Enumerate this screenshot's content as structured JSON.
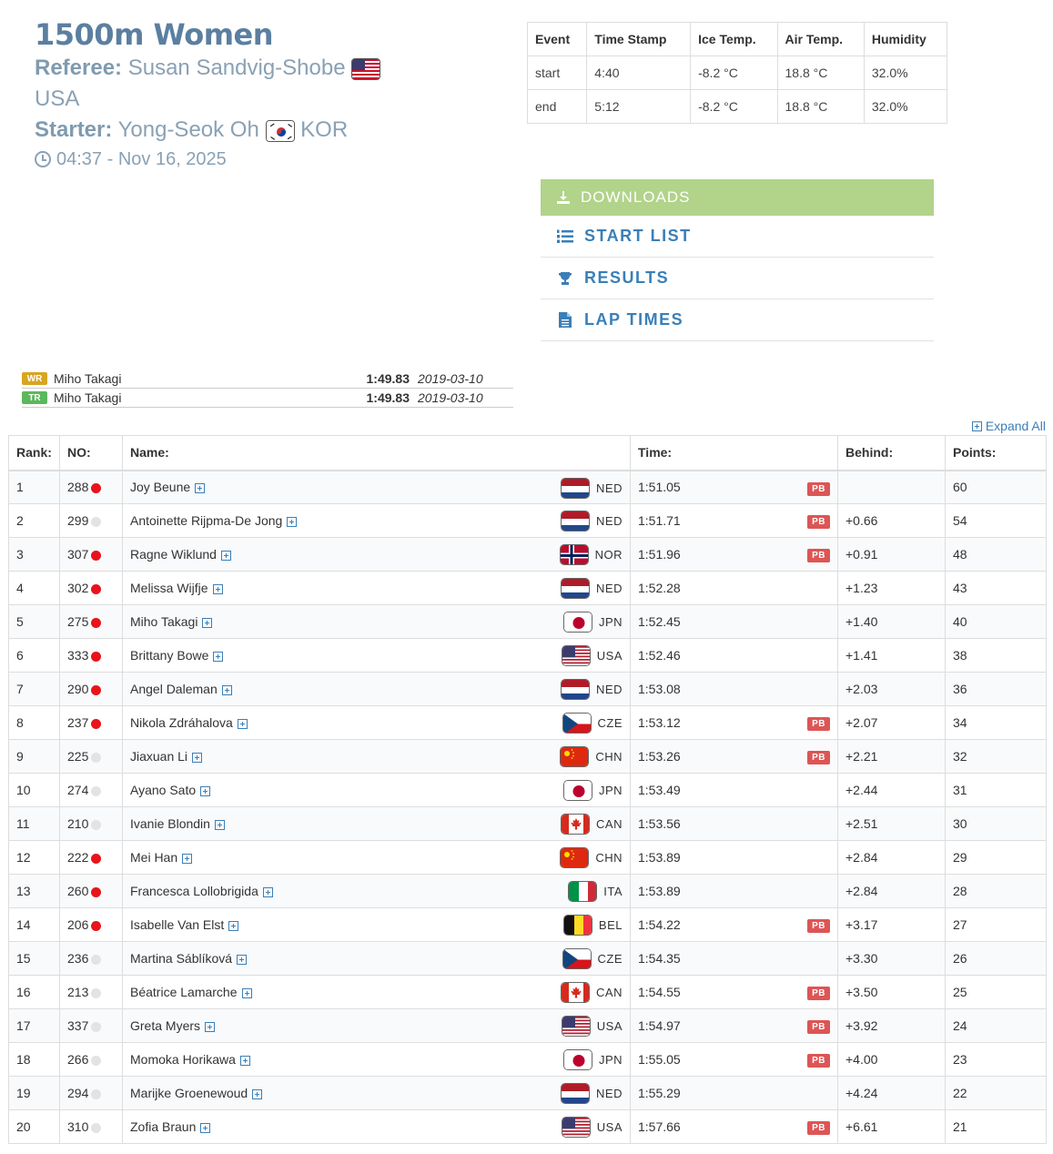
{
  "header": {
    "title": "1500m Women",
    "referee_label": "Referee:",
    "referee_name": "Susan Sandvig-Shobe",
    "referee_country": "USA",
    "starter_label": "Starter:",
    "starter_name": "Yong-Seok Oh",
    "starter_country": "KOR",
    "datetime": "04:37 - Nov 16, 2025"
  },
  "conditions": {
    "headers": [
      "Event",
      "Time Stamp",
      "Ice Temp.",
      "Air Temp.",
      "Humidity"
    ],
    "rows": [
      [
        "start",
        "4:40",
        "-8.2 °C",
        "18.8 °C",
        "32.0%"
      ],
      [
        "end",
        "5:12",
        "-8.2 °C",
        "18.8 °C",
        "32.0%"
      ]
    ]
  },
  "downloads": {
    "title": "DOWNLOADS",
    "items": [
      "START LIST",
      "RESULTS",
      "LAP TIMES"
    ]
  },
  "records": [
    {
      "badge": "WR",
      "color": "#d9a520",
      "name": "Miho Takagi",
      "time": "1:49.83",
      "date": "2019-03-10"
    },
    {
      "badge": "TR",
      "color": "#5cb85c",
      "name": "Miho Takagi",
      "time": "1:49.83",
      "date": "2019-03-10"
    }
  ],
  "expand_all": "Expand All",
  "results": {
    "headers": [
      "Rank:",
      "NO:",
      "Name:",
      "Time:",
      "Behind:",
      "Points:"
    ],
    "rows": [
      {
        "rank": "1",
        "no": "288",
        "dot": "red",
        "name": "Joy Beune",
        "country": "NED",
        "time": "1:51.05",
        "pb": true,
        "behind": "",
        "points": "60"
      },
      {
        "rank": "2",
        "no": "299",
        "dot": "grey",
        "name": "Antoinette Rijpma-De Jong",
        "country": "NED",
        "time": "1:51.71",
        "pb": true,
        "behind": "+0.66",
        "points": "54"
      },
      {
        "rank": "3",
        "no": "307",
        "dot": "red",
        "name": "Ragne Wiklund",
        "country": "NOR",
        "time": "1:51.96",
        "pb": true,
        "behind": "+0.91",
        "points": "48"
      },
      {
        "rank": "4",
        "no": "302",
        "dot": "red",
        "name": "Melissa Wijfje",
        "country": "NED",
        "time": "1:52.28",
        "pb": false,
        "behind": "+1.23",
        "points": "43"
      },
      {
        "rank": "5",
        "no": "275",
        "dot": "red",
        "name": "Miho Takagi",
        "country": "JPN",
        "time": "1:52.45",
        "pb": false,
        "behind": "+1.40",
        "points": "40"
      },
      {
        "rank": "6",
        "no": "333",
        "dot": "red",
        "name": "Brittany Bowe",
        "country": "USA",
        "time": "1:52.46",
        "pb": false,
        "behind": "+1.41",
        "points": "38"
      },
      {
        "rank": "7",
        "no": "290",
        "dot": "red",
        "name": "Angel Daleman",
        "country": "NED",
        "time": "1:53.08",
        "pb": false,
        "behind": "+2.03",
        "points": "36"
      },
      {
        "rank": "8",
        "no": "237",
        "dot": "red",
        "name": "Nikola Zdráhalova",
        "country": "CZE",
        "time": "1:53.12",
        "pb": true,
        "behind": "+2.07",
        "points": "34"
      },
      {
        "rank": "9",
        "no": "225",
        "dot": "grey",
        "name": "Jiaxuan Li",
        "country": "CHN",
        "time": "1:53.26",
        "pb": true,
        "behind": "+2.21",
        "points": "32"
      },
      {
        "rank": "10",
        "no": "274",
        "dot": "grey",
        "name": "Ayano Sato",
        "country": "JPN",
        "time": "1:53.49",
        "pb": false,
        "behind": "+2.44",
        "points": "31"
      },
      {
        "rank": "11",
        "no": "210",
        "dot": "grey",
        "name": "Ivanie Blondin",
        "country": "CAN",
        "time": "1:53.56",
        "pb": false,
        "behind": "+2.51",
        "points": "30"
      },
      {
        "rank": "12",
        "no": "222",
        "dot": "red",
        "name": "Mei Han",
        "country": "CHN",
        "time": "1:53.89",
        "pb": false,
        "behind": "+2.84",
        "points": "29"
      },
      {
        "rank": "13",
        "no": "260",
        "dot": "red",
        "name": "Francesca Lollobrigida",
        "country": "ITA",
        "time": "1:53.89",
        "pb": false,
        "behind": "+2.84",
        "points": "28"
      },
      {
        "rank": "14",
        "no": "206",
        "dot": "red",
        "name": "Isabelle Van Elst",
        "country": "BEL",
        "time": "1:54.22",
        "pb": true,
        "behind": "+3.17",
        "points": "27"
      },
      {
        "rank": "15",
        "no": "236",
        "dot": "grey",
        "name": "Martina Sáblíková",
        "country": "CZE",
        "time": "1:54.35",
        "pb": false,
        "behind": "+3.30",
        "points": "26"
      },
      {
        "rank": "16",
        "no": "213",
        "dot": "grey",
        "name": "Béatrice Lamarche",
        "country": "CAN",
        "time": "1:54.55",
        "pb": true,
        "behind": "+3.50",
        "points": "25"
      },
      {
        "rank": "17",
        "no": "337",
        "dot": "grey",
        "name": "Greta Myers",
        "country": "USA",
        "time": "1:54.97",
        "pb": true,
        "behind": "+3.92",
        "points": "24"
      },
      {
        "rank": "18",
        "no": "266",
        "dot": "grey",
        "name": "Momoka Horikawa",
        "country": "JPN",
        "time": "1:55.05",
        "pb": true,
        "behind": "+4.00",
        "points": "23"
      },
      {
        "rank": "19",
        "no": "294",
        "dot": "grey",
        "name": "Marijke Groenewoud",
        "country": "NED",
        "time": "1:55.29",
        "pb": false,
        "behind": "+4.24",
        "points": "22"
      },
      {
        "rank": "20",
        "no": "310",
        "dot": "grey",
        "name": "Zofia Braun",
        "country": "USA",
        "time": "1:57.66",
        "pb": true,
        "behind": "+6.61",
        "points": "21"
      }
    ],
    "pb_label": "PB"
  }
}
